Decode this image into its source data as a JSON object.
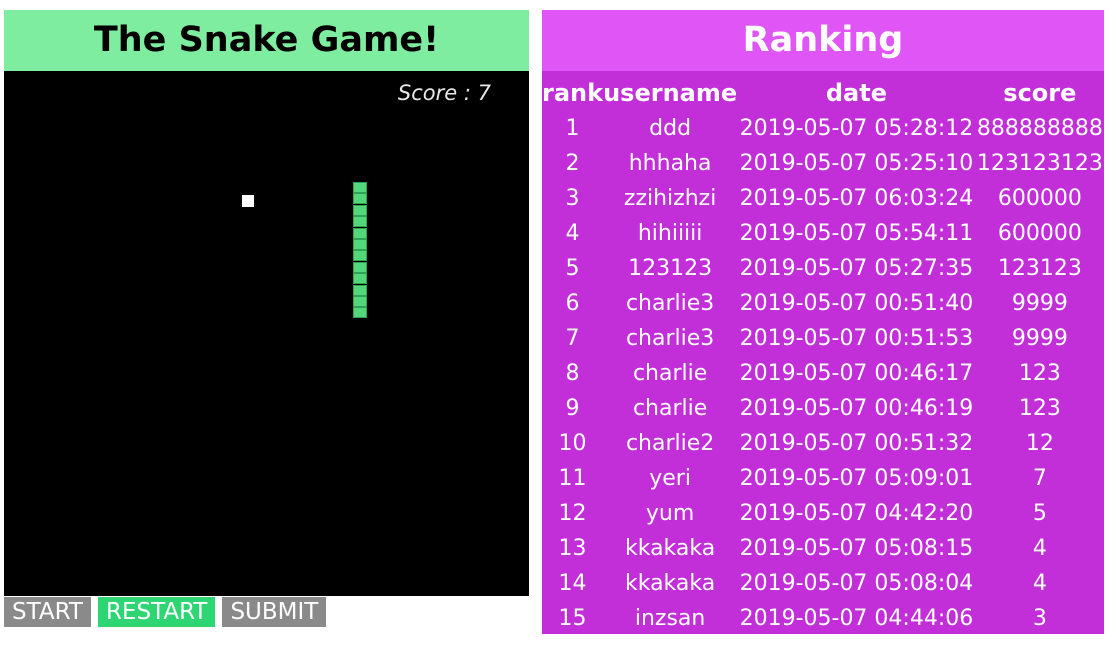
{
  "game": {
    "title": "The Snake Game!",
    "score_text": "Score : 7",
    "food_icon": "food-square",
    "snake_color": "#53d77a"
  },
  "buttons": {
    "start": "START",
    "restart": "RESTART",
    "submit": "SUBMIT"
  },
  "ranking": {
    "title": "Ranking",
    "headers": [
      "rank",
      "username",
      "date",
      "score"
    ],
    "rows": [
      [
        "1",
        "ddd",
        "2019-05-07 05:28:12",
        "888888888"
      ],
      [
        "2",
        "hhhaha",
        "2019-05-07 05:25:10",
        "123123123"
      ],
      [
        "3",
        "zzihizhzi",
        "2019-05-07 06:03:24",
        "600000"
      ],
      [
        "4",
        "hihiiiii",
        "2019-05-07 05:54:11",
        "600000"
      ],
      [
        "5",
        "123123",
        "2019-05-07 05:27:35",
        "123123"
      ],
      [
        "6",
        "charlie3",
        "2019-05-07 00:51:40",
        "9999"
      ],
      [
        "7",
        "charlie3",
        "2019-05-07 00:51:53",
        "9999"
      ],
      [
        "8",
        "charlie",
        "2019-05-07 00:46:17",
        "123"
      ],
      [
        "9",
        "charlie",
        "2019-05-07 00:46:19",
        "123"
      ],
      [
        "10",
        "charlie2",
        "2019-05-07 00:51:32",
        "12"
      ],
      [
        "11",
        "yeri",
        "2019-05-07 05:09:01",
        "7"
      ],
      [
        "12",
        "yum",
        "2019-05-07 04:42:20",
        "5"
      ],
      [
        "13",
        "kkakaka",
        "2019-05-07 05:08:15",
        "4"
      ],
      [
        "14",
        "kkakaka",
        "2019-05-07 05:08:04",
        "4"
      ],
      [
        "15",
        "inzsan",
        "2019-05-07 04:44:06",
        "3"
      ]
    ]
  }
}
